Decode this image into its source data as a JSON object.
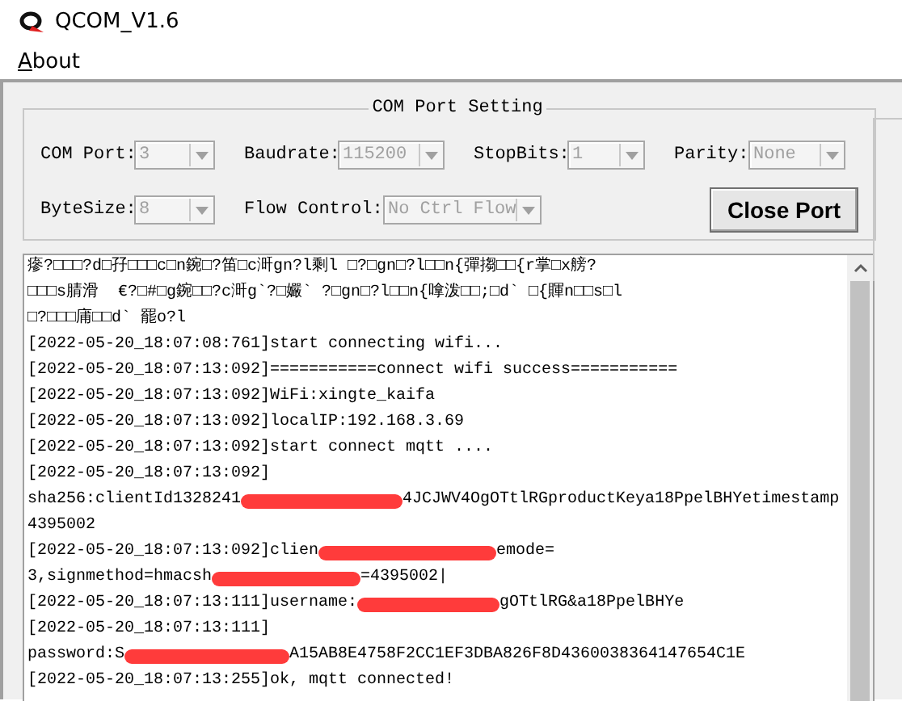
{
  "window": {
    "title": "QCOM_V1.6"
  },
  "menu": [
    {
      "label": "About"
    }
  ],
  "com_port_setting": {
    "title": "COM Port Setting",
    "rows": [
      [
        {
          "label": "COM Port:",
          "value": "3",
          "disabled": true
        },
        {
          "label": "Baudrate:",
          "value": "115200",
          "disabled": true
        },
        {
          "label": "StopBits:",
          "value": "1",
          "disabled": true
        },
        {
          "label": "Parity:",
          "value": "None",
          "disabled": true
        }
      ],
      [
        {
          "label": "ByteSize:",
          "value": "8",
          "disabled": true
        },
        {
          "label": "Flow Control:",
          "value": "No Ctrl Flow",
          "disabled": true
        }
      ]
    ],
    "button": "Close Port"
  },
  "log": [
    {
      "parts": [
        "瘮?□□□?d□孖□□□c□n鋺□?笛□c涆gn?l剩l □?□gn□?l□□n{彈搊□□{r掌□x艕?"
      ]
    },
    {
      "parts": [
        "□□□s腈滑  €?□#□g鋺□□?c涆g`?□孍` ?□gn□?l□□n{嗱泼□□;□d` □{賱n□□s□l"
      ]
    },
    {
      "parts": [
        "□?□□□庯□□d` 罷o?l"
      ]
    },
    {
      "parts": [
        "[2022-05-20_18:07:08:761]start connecting wifi..."
      ]
    },
    {
      "parts": [
        "[2022-05-20_18:07:13:092]===========connect wifi success==========="
      ]
    },
    {
      "parts": [
        "[2022-05-20_18:07:13:092]WiFi:xingte_kaifa"
      ]
    },
    {
      "parts": [
        "[2022-05-20_18:07:13:092]localIP:192.168.3.69"
      ]
    },
    {
      "parts": [
        "[2022-05-20_18:07:13:092]start connect mqtt ...."
      ]
    },
    {
      "parts": [
        "[2022-05-20_18:07:13:092]"
      ]
    },
    {
      "parts": [
        "sha256:clientId1328241",
        "4JCJWV4OgOTtlRGproductKeya18PpelBHYetimestamp"
      ]
    },
    {
      "parts": [
        "4395002"
      ]
    },
    {
      "parts": [
        "[2022-05-20_18:07:13:092]clien",
        "emode="
      ]
    },
    {
      "parts": [
        "3,signmethod=hmacsh",
        "=4395002|"
      ]
    },
    {
      "parts": [
        "[2022-05-20_18:07:13:111]username:",
        "gOTtlRG&a18PpelBHYe"
      ]
    },
    {
      "parts": [
        "[2022-05-20_18:07:13:111]"
      ]
    },
    {
      "parts": [
        "password:S",
        "A15AB8E4758F2CC1EF3DBA826F8D4360038364147654C1E"
      ]
    },
    {
      "parts": [
        "[2022-05-20_18:07:13:255]ok, mqtt connected!"
      ]
    }
  ]
}
